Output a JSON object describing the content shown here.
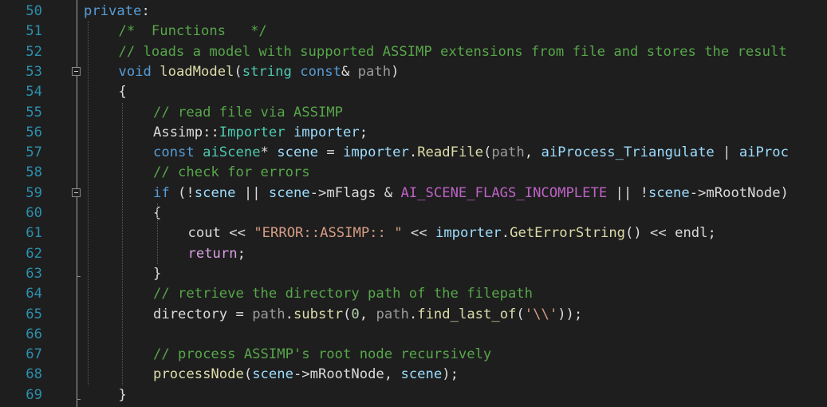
{
  "colors": {
    "background": "#1e1e1e",
    "line_number": "#2b91af",
    "keyword": "#569cd6",
    "comment": "#57a64a",
    "string": "#d69d85",
    "type": "#4ec9b0",
    "function": "#dcdcaa",
    "variable": "#9cdcfe",
    "parameter": "#9a9a9a",
    "macro": "#bd63c5",
    "member": "#dadada",
    "punctuation": "#dcdcdc",
    "control": "#d8a0df"
  },
  "lines": [
    {
      "num": "50",
      "indent": 0,
      "tokens": [
        {
          "t": "private",
          "c": "keyword"
        },
        {
          "t": ":",
          "c": "punctuation"
        }
      ]
    },
    {
      "num": "51",
      "indent": 1,
      "tokens": [
        {
          "t": "/*  Functions   */",
          "c": "comment"
        }
      ]
    },
    {
      "num": "52",
      "indent": 1,
      "tokens": [
        {
          "t": "// loads a model with supported ASSIMP extensions from file and stores the result",
          "c": "comment"
        }
      ]
    },
    {
      "num": "53",
      "indent": 1,
      "fold": true,
      "tokens": [
        {
          "t": "void",
          "c": "keyword"
        },
        {
          "t": " ",
          "c": "punctuation"
        },
        {
          "t": "loadModel",
          "c": "function"
        },
        {
          "t": "(",
          "c": "punctuation"
        },
        {
          "t": "string",
          "c": "type"
        },
        {
          "t": " ",
          "c": "punctuation"
        },
        {
          "t": "const",
          "c": "keyword"
        },
        {
          "t": "& ",
          "c": "punctuation"
        },
        {
          "t": "path",
          "c": "parameter"
        },
        {
          "t": ")",
          "c": "punctuation"
        }
      ]
    },
    {
      "num": "54",
      "indent": 1,
      "tokens": [
        {
          "t": "{",
          "c": "punctuation"
        }
      ]
    },
    {
      "num": "55",
      "indent": 2,
      "tokens": [
        {
          "t": "// read file via ASSIMP",
          "c": "comment"
        }
      ]
    },
    {
      "num": "56",
      "indent": 2,
      "tokens": [
        {
          "t": "Assimp",
          "c": "member"
        },
        {
          "t": "::",
          "c": "punctuation"
        },
        {
          "t": "Importer",
          "c": "type"
        },
        {
          "t": " ",
          "c": "punctuation"
        },
        {
          "t": "importer",
          "c": "variable"
        },
        {
          "t": ";",
          "c": "punctuation"
        }
      ]
    },
    {
      "num": "57",
      "indent": 2,
      "tokens": [
        {
          "t": "const",
          "c": "keyword"
        },
        {
          "t": " ",
          "c": "punctuation"
        },
        {
          "t": "aiScene",
          "c": "type"
        },
        {
          "t": "* ",
          "c": "punctuation"
        },
        {
          "t": "scene",
          "c": "variable"
        },
        {
          "t": " = ",
          "c": "punctuation"
        },
        {
          "t": "importer",
          "c": "variable"
        },
        {
          "t": ".",
          "c": "punctuation"
        },
        {
          "t": "ReadFile",
          "c": "function"
        },
        {
          "t": "(",
          "c": "punctuation"
        },
        {
          "t": "path",
          "c": "parameter"
        },
        {
          "t": ", ",
          "c": "punctuation"
        },
        {
          "t": "aiProcess_Triangulate",
          "c": "variable"
        },
        {
          "t": " | ",
          "c": "punctuation"
        },
        {
          "t": "aiProc",
          "c": "variable"
        }
      ]
    },
    {
      "num": "58",
      "indent": 2,
      "tokens": [
        {
          "t": "// check for errors",
          "c": "comment"
        }
      ]
    },
    {
      "num": "59",
      "indent": 2,
      "fold": true,
      "tokens": [
        {
          "t": "if",
          "c": "keyword"
        },
        {
          "t": " (!",
          "c": "punctuation"
        },
        {
          "t": "scene",
          "c": "variable"
        },
        {
          "t": " || ",
          "c": "punctuation"
        },
        {
          "t": "scene",
          "c": "variable"
        },
        {
          "t": "->",
          "c": "punctuation"
        },
        {
          "t": "mFlags",
          "c": "member"
        },
        {
          "t": " & ",
          "c": "punctuation"
        },
        {
          "t": "AI_SCENE_FLAGS_INCOMPLETE",
          "c": "macro"
        },
        {
          "t": " || !",
          "c": "punctuation"
        },
        {
          "t": "scene",
          "c": "variable"
        },
        {
          "t": "->",
          "c": "punctuation"
        },
        {
          "t": "mRootNode",
          "c": "member"
        },
        {
          "t": ")",
          "c": "punctuation"
        }
      ]
    },
    {
      "num": "60",
      "indent": 2,
      "tokens": [
        {
          "t": "{",
          "c": "punctuation"
        }
      ]
    },
    {
      "num": "61",
      "indent": 3,
      "tokens": [
        {
          "t": "cout",
          "c": "member"
        },
        {
          "t": " << ",
          "c": "punctuation"
        },
        {
          "t": "\"ERROR::ASSIMP:: \"",
          "c": "string"
        },
        {
          "t": " << ",
          "c": "punctuation"
        },
        {
          "t": "importer",
          "c": "variable"
        },
        {
          "t": ".",
          "c": "punctuation"
        },
        {
          "t": "GetErrorString",
          "c": "function"
        },
        {
          "t": "() << ",
          "c": "punctuation"
        },
        {
          "t": "endl",
          "c": "member"
        },
        {
          "t": ";",
          "c": "punctuation"
        }
      ]
    },
    {
      "num": "62",
      "indent": 3,
      "tokens": [
        {
          "t": "return",
          "c": "control"
        },
        {
          "t": ";",
          "c": "punctuation"
        }
      ]
    },
    {
      "num": "63",
      "indent": 2,
      "tokens": [
        {
          "t": "}",
          "c": "punctuation"
        }
      ]
    },
    {
      "num": "64",
      "indent": 2,
      "tokens": [
        {
          "t": "// retrieve the directory path of the filepath",
          "c": "comment"
        }
      ]
    },
    {
      "num": "65",
      "indent": 2,
      "tokens": [
        {
          "t": "directory",
          "c": "member"
        },
        {
          "t": " = ",
          "c": "punctuation"
        },
        {
          "t": "path",
          "c": "parameter"
        },
        {
          "t": ".",
          "c": "punctuation"
        },
        {
          "t": "substr",
          "c": "function"
        },
        {
          "t": "(",
          "c": "punctuation"
        },
        {
          "t": "0",
          "c": "number"
        },
        {
          "t": ", ",
          "c": "punctuation"
        },
        {
          "t": "path",
          "c": "parameter"
        },
        {
          "t": ".",
          "c": "punctuation"
        },
        {
          "t": "find_last_of",
          "c": "function"
        },
        {
          "t": "(",
          "c": "punctuation"
        },
        {
          "t": "'\\\\'",
          "c": "string"
        },
        {
          "t": "));",
          "c": "punctuation"
        }
      ]
    },
    {
      "num": "66",
      "indent": 0,
      "tokens": []
    },
    {
      "num": "67",
      "indent": 2,
      "tokens": [
        {
          "t": "// process ASSIMP's root node recursively",
          "c": "comment"
        }
      ]
    },
    {
      "num": "68",
      "indent": 2,
      "tokens": [
        {
          "t": "processNode",
          "c": "function"
        },
        {
          "t": "(",
          "c": "punctuation"
        },
        {
          "t": "scene",
          "c": "variable"
        },
        {
          "t": "->",
          "c": "punctuation"
        },
        {
          "t": "mRootNode",
          "c": "member"
        },
        {
          "t": ", ",
          "c": "punctuation"
        },
        {
          "t": "scene",
          "c": "variable"
        },
        {
          "t": ");",
          "c": "punctuation"
        }
      ]
    },
    {
      "num": "69",
      "indent": 1,
      "tokens": [
        {
          "t": "}",
          "c": "punctuation"
        }
      ]
    }
  ]
}
